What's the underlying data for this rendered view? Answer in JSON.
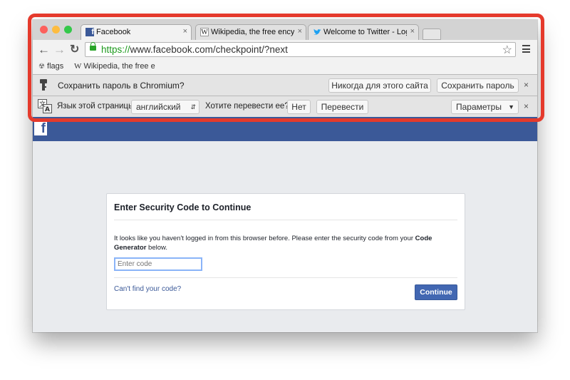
{
  "browser": {
    "tabs": [
      {
        "title": "Facebook",
        "icon": "facebook-favicon",
        "active": true
      },
      {
        "title": "Wikipedia, the free encyclo",
        "icon": "wikipedia-favicon",
        "active": false
      },
      {
        "title": "Welcome to Twitter - Login",
        "icon": "twitter-favicon",
        "active": false
      }
    ],
    "close_glyph": "×",
    "url_scheme": "https://",
    "url_rest": "www.facebook.com/checkpoint/?next",
    "bookmarks": [
      {
        "label": "flags",
        "icon": "flags-icon"
      },
      {
        "label": "Wikipedia, the free e",
        "icon": "wikipedia-favicon"
      }
    ],
    "password_bar": {
      "text": "Сохранить пароль в Chromium?",
      "never_button": "Никогда для этого сайта",
      "save_button": "Сохранить пароль"
    },
    "translate_bar": {
      "label": "Язык этой страницы",
      "language": "английский",
      "question": "Хотите перевести ее?",
      "no_button": "Нет",
      "translate_button": "Перевести",
      "options_button": "Параметры"
    }
  },
  "page": {
    "logo": "f",
    "card": {
      "title": "Enter Security Code to Continue",
      "message_start": "It looks like you haven't logged in from this browser before. Please enter the security code from your ",
      "message_bold": "Code Generator",
      "message_end": " below.",
      "input_placeholder": "Enter code",
      "help_link": "Can't find your code?",
      "continue_button": "Continue"
    }
  },
  "colors": {
    "highlight": "#e53a2c",
    "facebook_blue": "#3b5998",
    "https_green": "#1e9a1e"
  }
}
